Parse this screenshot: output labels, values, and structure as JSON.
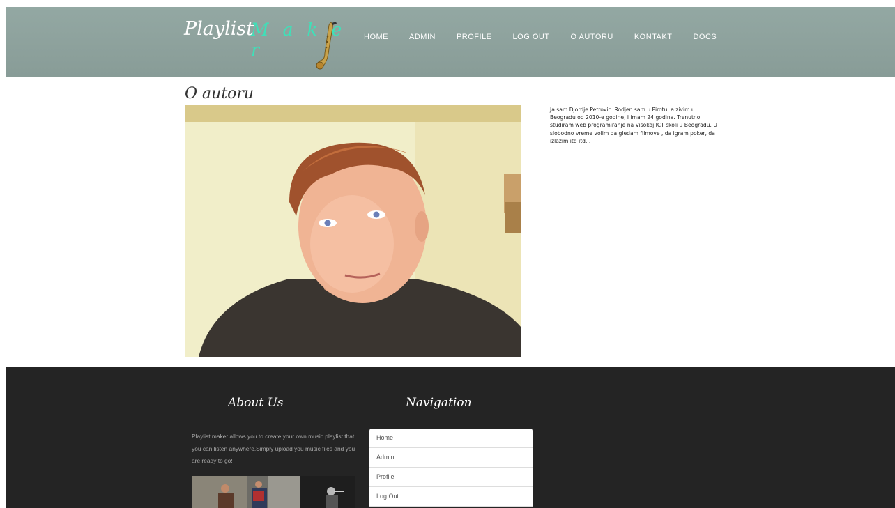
{
  "header": {
    "brand_main": "Playlist",
    "brand_accent": "M a k e r",
    "nav": [
      "HOME",
      "ADMIN",
      "PROFILE",
      "LOG OUT",
      "O AUTORU",
      "KONTAKT",
      "DOCS"
    ]
  },
  "main": {
    "title": "O autoru",
    "bio": "Ja sam Djordje Petrovic. Rodjen sam u Pirotu, a zivim u Beogradu od 2010-e godine, i imam 24 godina. Trenutno studiram web programiranje na Visokoj ICT skoli u Beogradu. U slobodno vreme volim da gledam filmove , da igram poker, da izlazim itd itd..."
  },
  "footer": {
    "about_heading": "About Us",
    "about_text": "Playlist maker allows you to create your own music playlist that you can listen anywhere.Simply upload you music files and you are ready to go!",
    "nav_heading": "Navigation",
    "nav_items": [
      "Home",
      "Admin",
      "Profile",
      "Log Out"
    ]
  },
  "colors": {
    "header_bg": "#8fa39e",
    "brand_accent": "#3fe0b8",
    "footer_bg": "#242424"
  },
  "icons": {
    "logo_icon": "saxophone-icon"
  }
}
